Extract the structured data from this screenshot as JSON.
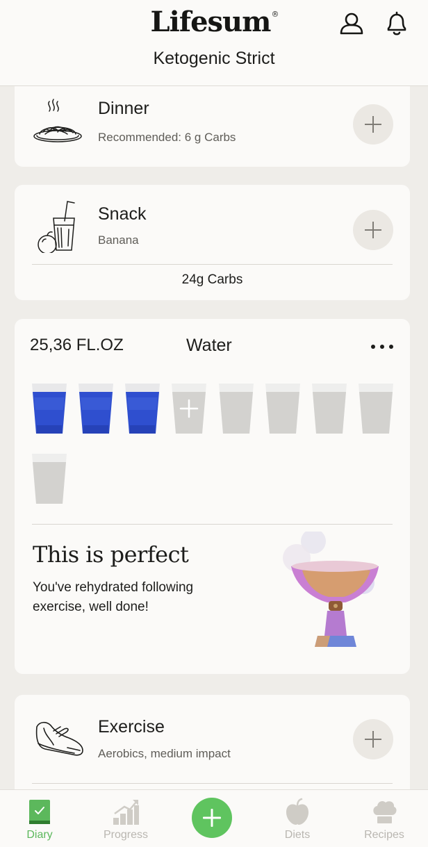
{
  "header": {
    "logo_text": "Lifesum",
    "logo_mark": "®",
    "diet_name": "Ketogenic Strict",
    "icons": [
      "profile-icon",
      "bell-icon"
    ]
  },
  "meals": {
    "dinner": {
      "title": "Dinner",
      "subtitle": "Recommended: 6 g Carbs",
      "icon": "spaghetti-plate-icon"
    },
    "snack": {
      "title": "Snack",
      "subtitle": "Banana",
      "carbs_total": "24g Carbs",
      "icon": "smoothie-apple-icon"
    },
    "exercise": {
      "title": "Exercise",
      "subtitle": "Aerobics, medium impact",
      "icon": "sneaker-icon"
    }
  },
  "water": {
    "amount": "25,36 FL.OZ",
    "title": "Water",
    "glasses_filled": 3,
    "glasses_total": 9,
    "feedback_title": "This is perfect",
    "feedback_message": "You've rehydrated following exercise, well done!",
    "filled_color": "#2f4fcf",
    "empty_color": "#d7d6d3"
  },
  "nav": {
    "items": [
      {
        "label": "Diary",
        "icon": "diary-book-icon",
        "active": true
      },
      {
        "label": "Progress",
        "icon": "progress-chart-icon",
        "active": false
      },
      {
        "label": "Diets",
        "icon": "apple-icon",
        "active": false
      },
      {
        "label": "Recipes",
        "icon": "chef-hat-icon",
        "active": false
      }
    ],
    "add_icon": "plus-icon"
  },
  "colors": {
    "accent_green": "#5fc45f",
    "background": "#efede9",
    "card": "#fbfaf8"
  }
}
